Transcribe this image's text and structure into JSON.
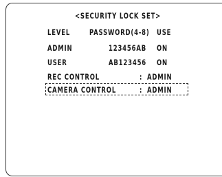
{
  "menu": {
    "title": "<SECURITY LOCK SET>",
    "header": {
      "level": "LEVEL",
      "password": "PASSWORD(4-8)",
      "use": "USE"
    },
    "users": [
      {
        "level": "ADMIN",
        "password": "123456AB",
        "use": "ON"
      },
      {
        "level": "USER",
        "password": "AB123456",
        "use": "ON"
      }
    ],
    "controls": [
      {
        "label": "REC CONTROL",
        "sep": ":",
        "value": "ADMIN"
      },
      {
        "label": "CAMERA CONTROL",
        "sep": ":",
        "value": "ADMIN"
      }
    ]
  }
}
